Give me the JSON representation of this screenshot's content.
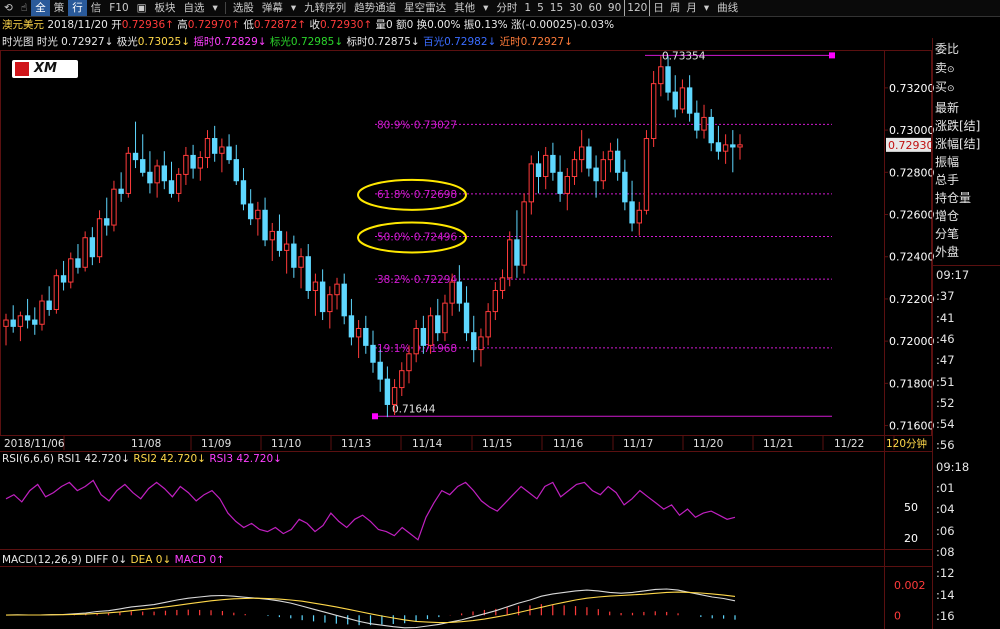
{
  "toolbar": {
    "items": [
      "全",
      "策",
      "行",
      "信",
      "F10",
      "板块",
      "自选",
      "选股",
      "弹幕",
      "九转序列",
      "趋势通道",
      "星空雷达",
      "其他"
    ],
    "period_label": "分时",
    "periods": [
      "1",
      "5",
      "15",
      "30",
      "60",
      "90",
      "120",
      "日",
      "周",
      "月"
    ],
    "active_period": "120",
    "right_label": "曲线"
  },
  "info1": {
    "name": "澳元美元",
    "date": "2018/11/20",
    "open_label": "开",
    "open": "0.72936",
    "high_label": "高",
    "high": "0.72970",
    "low_label": "低",
    "low": "0.72872",
    "close_label": "收",
    "close": "0.72930",
    "vol_label": "量",
    "vol": "0",
    "amt_label": "额",
    "amt": "0",
    "turn_label": "换",
    "turn": "0.00%",
    "amp_label": "振",
    "amp": "0.13%",
    "chg_label": "涨",
    "chg": "(-0.00025)-0.03%"
  },
  "info2": {
    "a_label": "时光图",
    "a": "时光 0.72927",
    "b_label": "极光",
    "b": "0.73025",
    "c_label": "摇时",
    "c": "0.72829",
    "d_label": "标光",
    "d": "0.72985",
    "e_label": "标时",
    "e": "0.72875",
    "f_label": "百光",
    "f": "0.72982",
    "g_label": "近时",
    "g": "0.72927"
  },
  "logo": {
    "text": "XM"
  },
  "right_panel": {
    "items": [
      "委比",
      "卖",
      "买",
      "最新",
      "涨跌[结]",
      "涨幅[结]",
      "振幅",
      "总手",
      "持仓量",
      "增仓",
      "分笔",
      "外盘"
    ],
    "times": [
      "09:17",
      ":37",
      ":41",
      ":46",
      ":47",
      ":51",
      ":52",
      ":54",
      ":56",
      "09:18",
      ":01",
      ":04",
      ":06",
      ":08",
      ":12",
      ":14",
      ":16"
    ]
  },
  "colors": {
    "up": "#ff3b3b",
    "down": "#5fd8ff",
    "fib": "#d01ad0",
    "rsi": "#c020c0",
    "diff": "#d8d8d8",
    "dea": "#ffd84a",
    "ellipse": "#ffe800"
  },
  "chart_data": [
    {
      "type": "candlestick",
      "title": "澳元美元 120分钟",
      "xlabel": "120分钟",
      "x_ticks": [
        "2018/11/06",
        "11/08",
        "11/09",
        "11/10",
        "11/13",
        "11/14",
        "11/15",
        "11/16",
        "11/17",
        "11/20",
        "11/21",
        "11/22"
      ],
      "y_ticks": [
        "0.73200",
        "0.73000",
        "0.72800",
        "0.72600",
        "0.72400",
        "0.72200",
        "0.72000",
        "0.71800",
        "0.71600"
      ],
      "ylim": [
        0.7156,
        0.7337
      ],
      "last_price": "0.72930",
      "candles": [
        [
          0.7207,
          0.7213,
          0.7198,
          0.721
        ],
        [
          0.721,
          0.7217,
          0.7204,
          0.7207
        ],
        [
          0.7207,
          0.7214,
          0.72,
          0.7212
        ],
        [
          0.7212,
          0.722,
          0.7206,
          0.721
        ],
        [
          0.721,
          0.7216,
          0.7203,
          0.7208
        ],
        [
          0.7208,
          0.7222,
          0.7205,
          0.7219
        ],
        [
          0.7219,
          0.7226,
          0.7212,
          0.7215
        ],
        [
          0.7215,
          0.7234,
          0.7213,
          0.7231
        ],
        [
          0.7231,
          0.7238,
          0.7224,
          0.7228
        ],
        [
          0.7228,
          0.7242,
          0.7225,
          0.7239
        ],
        [
          0.7239,
          0.7246,
          0.7232,
          0.7235
        ],
        [
          0.7235,
          0.7252,
          0.7233,
          0.7249
        ],
        [
          0.7249,
          0.7254,
          0.7236,
          0.724
        ],
        [
          0.724,
          0.7262,
          0.7237,
          0.7258
        ],
        [
          0.7258,
          0.7268,
          0.725,
          0.7255
        ],
        [
          0.7255,
          0.7276,
          0.7252,
          0.7272
        ],
        [
          0.7272,
          0.728,
          0.7266,
          0.727
        ],
        [
          0.727,
          0.7292,
          0.7268,
          0.7289
        ],
        [
          0.7289,
          0.7304,
          0.7282,
          0.7286
        ],
        [
          0.7286,
          0.7298,
          0.7278,
          0.728
        ],
        [
          0.728,
          0.729,
          0.727,
          0.7275
        ],
        [
          0.7275,
          0.7286,
          0.7268,
          0.7283
        ],
        [
          0.7283,
          0.729,
          0.7272,
          0.7276
        ],
        [
          0.7276,
          0.7285,
          0.7268,
          0.727
        ],
        [
          0.727,
          0.7282,
          0.7266,
          0.7279
        ],
        [
          0.7279,
          0.7292,
          0.7274,
          0.7288
        ],
        [
          0.7288,
          0.7293,
          0.7277,
          0.7282
        ],
        [
          0.7282,
          0.729,
          0.7276,
          0.7287
        ],
        [
          0.7287,
          0.73,
          0.7282,
          0.7296
        ],
        [
          0.7296,
          0.7302,
          0.7285,
          0.7289
        ],
        [
          0.7289,
          0.7296,
          0.728,
          0.7292
        ],
        [
          0.7292,
          0.7298,
          0.7284,
          0.7286
        ],
        [
          0.7286,
          0.7293,
          0.7274,
          0.7276
        ],
        [
          0.7276,
          0.7282,
          0.7262,
          0.7265
        ],
        [
          0.7265,
          0.7272,
          0.7255,
          0.7258
        ],
        [
          0.7258,
          0.7266,
          0.725,
          0.7262
        ],
        [
          0.7262,
          0.7268,
          0.7245,
          0.7248
        ],
        [
          0.7248,
          0.7256,
          0.7238,
          0.7252
        ],
        [
          0.7252,
          0.726,
          0.724,
          0.7243
        ],
        [
          0.7243,
          0.7252,
          0.7232,
          0.7246
        ],
        [
          0.7246,
          0.725,
          0.723,
          0.7235
        ],
        [
          0.7235,
          0.7244,
          0.7225,
          0.724
        ],
        [
          0.724,
          0.7246,
          0.722,
          0.7224
        ],
        [
          0.7224,
          0.7232,
          0.7212,
          0.7228
        ],
        [
          0.7228,
          0.7234,
          0.721,
          0.7214
        ],
        [
          0.7214,
          0.7226,
          0.7206,
          0.7222
        ],
        [
          0.7222,
          0.723,
          0.7215,
          0.7227
        ],
        [
          0.7227,
          0.7232,
          0.7208,
          0.7212
        ],
        [
          0.7212,
          0.722,
          0.7198,
          0.7202
        ],
        [
          0.7202,
          0.721,
          0.7192,
          0.7206
        ],
        [
          0.7206,
          0.7212,
          0.7194,
          0.7198
        ],
        [
          0.7198,
          0.7205,
          0.7185,
          0.719
        ],
        [
          0.719,
          0.7196,
          0.7176,
          0.7182
        ],
        [
          0.7182,
          0.7188,
          0.7164,
          0.717
        ],
        [
          0.717,
          0.7182,
          0.7165,
          0.7178
        ],
        [
          0.7178,
          0.719,
          0.7174,
          0.7186
        ],
        [
          0.7186,
          0.7198,
          0.718,
          0.7194
        ],
        [
          0.7194,
          0.721,
          0.719,
          0.7206
        ],
        [
          0.7206,
          0.7212,
          0.7194,
          0.7198
        ],
        [
          0.7198,
          0.7216,
          0.7194,
          0.7212
        ],
        [
          0.7212,
          0.722,
          0.72,
          0.7204
        ],
        [
          0.7204,
          0.7222,
          0.72,
          0.7218
        ],
        [
          0.7218,
          0.7232,
          0.7212,
          0.7228
        ],
        [
          0.7228,
          0.7236,
          0.7214,
          0.7218
        ],
        [
          0.7218,
          0.7226,
          0.72,
          0.7204
        ],
        [
          0.7204,
          0.7212,
          0.719,
          0.7196
        ],
        [
          0.7196,
          0.7206,
          0.7188,
          0.7202
        ],
        [
          0.7202,
          0.7218,
          0.7198,
          0.7214
        ],
        [
          0.7214,
          0.7228,
          0.721,
          0.7224
        ],
        [
          0.7224,
          0.7234,
          0.722,
          0.723
        ],
        [
          0.723,
          0.7252,
          0.7226,
          0.7248
        ],
        [
          0.7248,
          0.7262,
          0.723,
          0.7236
        ],
        [
          0.7236,
          0.727,
          0.7232,
          0.7266
        ],
        [
          0.7266,
          0.7288,
          0.726,
          0.7284
        ],
        [
          0.7284,
          0.729,
          0.727,
          0.7278
        ],
        [
          0.7278,
          0.7292,
          0.7272,
          0.7288
        ],
        [
          0.7288,
          0.7294,
          0.7276,
          0.728
        ],
        [
          0.728,
          0.7288,
          0.7266,
          0.727
        ],
        [
          0.727,
          0.7282,
          0.7262,
          0.7278
        ],
        [
          0.7278,
          0.729,
          0.7274,
          0.7286
        ],
        [
          0.7286,
          0.73,
          0.728,
          0.7292
        ],
        [
          0.7292,
          0.7296,
          0.7278,
          0.7282
        ],
        [
          0.7282,
          0.7288,
          0.7268,
          0.7276
        ],
        [
          0.7276,
          0.729,
          0.7272,
          0.7286
        ],
        [
          0.7286,
          0.7294,
          0.728,
          0.729
        ],
        [
          0.729,
          0.7296,
          0.7276,
          0.728
        ],
        [
          0.728,
          0.7286,
          0.7262,
          0.7266
        ],
        [
          0.7266,
          0.7276,
          0.7252,
          0.7256
        ],
        [
          0.7256,
          0.7266,
          0.725,
          0.7262
        ],
        [
          0.7262,
          0.73,
          0.726,
          0.7296
        ],
        [
          0.7296,
          0.7328,
          0.7292,
          0.7322
        ],
        [
          0.7322,
          0.7335,
          0.7316,
          0.733
        ],
        [
          0.733,
          0.7335,
          0.7314,
          0.7318
        ],
        [
          0.7318,
          0.7326,
          0.7306,
          0.731
        ],
        [
          0.731,
          0.7324,
          0.7308,
          0.732
        ],
        [
          0.732,
          0.7326,
          0.7304,
          0.7308
        ],
        [
          0.7308,
          0.7314,
          0.7296,
          0.73
        ],
        [
          0.73,
          0.7312,
          0.7296,
          0.7306
        ],
        [
          0.7306,
          0.731,
          0.729,
          0.7294
        ],
        [
          0.7294,
          0.7302,
          0.7286,
          0.729
        ],
        [
          0.729,
          0.7298,
          0.7284,
          0.7293
        ],
        [
          0.7293,
          0.73,
          0.728,
          0.7292
        ],
        [
          0.7292,
          0.7298,
          0.7286,
          0.7293
        ]
      ],
      "fib_levels": [
        {
          "label": "80.9% 0.73027",
          "value": 0.73027
        },
        {
          "label": "61.8% 0.72698",
          "value": 0.72698
        },
        {
          "label": "50.0% 0.72496",
          "value": 0.72496
        },
        {
          "label": "38.2% 0.72294",
          "value": 0.72294
        },
        {
          "label": "19.1% 0.71968",
          "value": 0.71968
        }
      ],
      "swing_high": {
        "label": "0.73354",
        "value": 0.73354
      },
      "swing_low": {
        "label": "0.71644",
        "value": 0.71644
      },
      "highlighted_levels": [
        "61.8% 0.72698",
        "50.0% 0.72496"
      ]
    },
    {
      "type": "line",
      "title": "RSI(6,6,6)",
      "legend": [
        {
          "name": "RSI1",
          "value": "42.720"
        },
        {
          "name": "RSI2",
          "value": "42.720"
        },
        {
          "name": "RSI3",
          "value": "42.720"
        }
      ],
      "y_ticks": [
        "50",
        "20"
      ],
      "ylim": [
        10,
        90
      ],
      "values": [
        58,
        62,
        55,
        66,
        72,
        60,
        64,
        70,
        74,
        66,
        70,
        76,
        62,
        56,
        66,
        72,
        64,
        58,
        68,
        74,
        68,
        60,
        70,
        64,
        56,
        62,
        66,
        58,
        44,
        36,
        30,
        34,
        28,
        26,
        30,
        24,
        28,
        38,
        34,
        26,
        32,
        44,
        36,
        30,
        38,
        42,
        36,
        28,
        26,
        22,
        30,
        24,
        18,
        40,
        54,
        66,
        62,
        70,
        74,
        66,
        56,
        50,
        46,
        54,
        62,
        70,
        64,
        58,
        70,
        74,
        60,
        66,
        72,
        74,
        66,
        62,
        70,
        64,
        52,
        58,
        66,
        60,
        54,
        48,
        52,
        42,
        48,
        40,
        44,
        46,
        42,
        38,
        40
      ]
    },
    {
      "type": "line",
      "title": "MACD(12,26,9)",
      "legend": [
        {
          "name": "DIFF",
          "value": "0"
        },
        {
          "name": "DEA",
          "value": "0"
        },
        {
          "name": "MACD",
          "value": "0"
        }
      ],
      "y_ticks": [
        "0.002",
        "0"
      ],
      "ylim": [
        -0.0009,
        0.0031
      ],
      "series": [
        {
          "name": "DIFF",
          "values": [
            2e-05,
            3e-05,
            2e-05,
            2e-05,
            4e-05,
            5e-05,
            0.0001,
            0.00015,
            0.00025,
            0.0003,
            0.00042,
            0.00055,
            0.00062,
            0.0007,
            0.00085,
            0.001,
            0.00112,
            0.0012,
            0.00128,
            0.0013,
            0.00125,
            0.00118,
            0.00112,
            0.00105,
            0.00094,
            0.0008,
            0.0006,
            0.0004,
            0.0002,
            0.0,
            -0.0002,
            -0.0004,
            -0.00055,
            -0.00065,
            -0.00075,
            -0.00082,
            -0.0008,
            -0.0007,
            -0.0006,
            -0.00045,
            -0.0003,
            -0.0001,
            0.0001,
            0.0003,
            0.00055,
            0.0008,
            0.001,
            0.00125,
            0.0014,
            0.0015,
            0.0016,
            0.00165,
            0.0016,
            0.0015,
            0.00145,
            0.0015,
            0.0016,
            0.0017,
            0.00172,
            0.00165,
            0.0015,
            0.00135,
            0.0012,
            0.0011,
            0.00095
          ]
        },
        {
          "name": "DEA",
          "values": [
            1e-05,
            2e-05,
            2e-05,
            2e-05,
            3e-05,
            4e-05,
            6e-05,
            8e-05,
            0.00012,
            0.00016,
            0.00022,
            0.0003,
            0.00038,
            0.00046,
            0.00055,
            0.00065,
            0.00075,
            0.00085,
            0.00095,
            0.00102,
            0.00108,
            0.0011,
            0.00112,
            0.0011,
            0.00106,
            0.001,
            0.00092,
            0.0008,
            0.00068,
            0.00055,
            0.0004,
            0.00025,
            0.0001,
            -5e-05,
            -0.00018,
            -0.0003,
            -0.0004,
            -0.00045,
            -0.00048,
            -0.00047,
            -0.00042,
            -0.00035,
            -0.00025,
            -0.00012,
            2e-05,
            0.00018,
            0.00035,
            0.00052,
            0.0007,
            0.00085,
            0.001,
            0.00112,
            0.0012,
            0.00126,
            0.0013,
            0.00134,
            0.00138,
            0.00144,
            0.0015,
            0.00152,
            0.0015,
            0.00146,
            0.0014,
            0.00132,
            0.00124
          ]
        }
      ],
      "histogram": [
        0,
        1,
        0,
        0,
        1,
        1,
        4,
        7,
        13,
        14,
        20,
        25,
        24,
        24,
        30,
        35,
        37,
        35,
        33,
        28,
        17,
        8,
        0,
        -5,
        -12,
        -20,
        -32,
        -40,
        -48,
        -55,
        -60,
        -65,
        -65,
        -60,
        -57,
        -52,
        -40,
        -25,
        -12,
        2,
        12,
        25,
        35,
        42,
        53,
        62,
        65,
        73,
        70,
        65,
        60,
        53,
        40,
        24,
        15,
        16,
        22,
        26,
        22,
        13,
        0,
        -11,
        -20,
        -22,
        -29
      ]
    }
  ]
}
